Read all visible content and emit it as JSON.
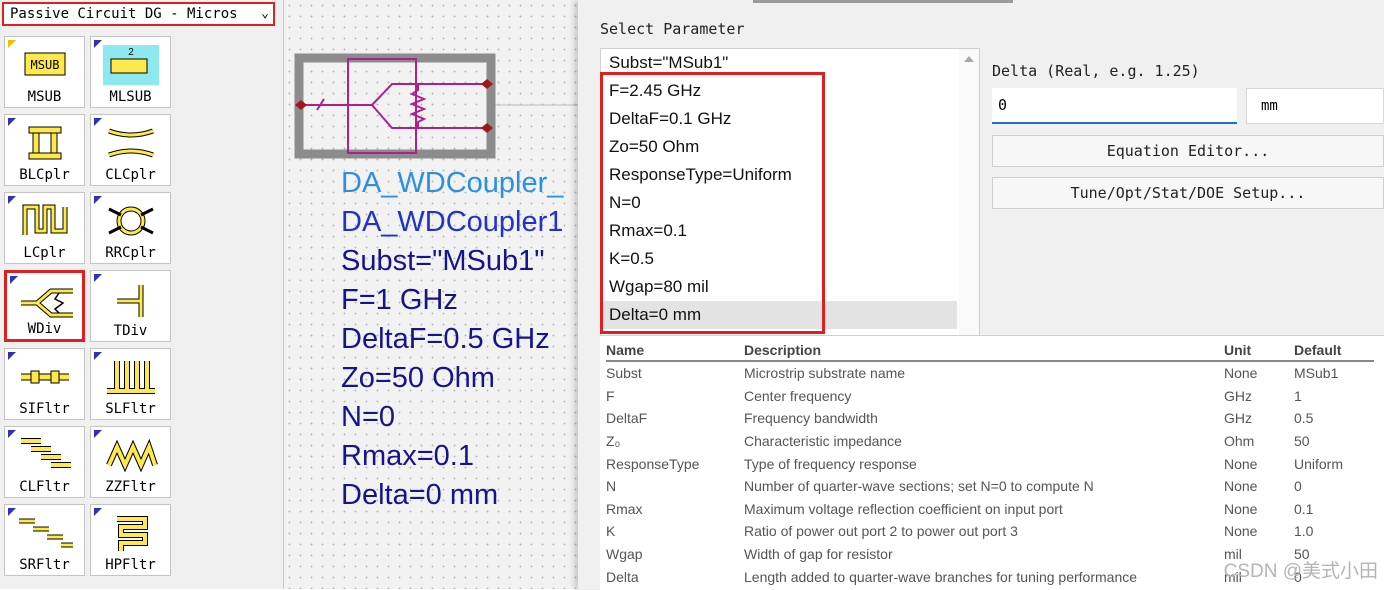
{
  "library_selector": {
    "value": "Passive Circuit DG - Micros"
  },
  "palette": {
    "items": [
      {
        "label": "MSUB",
        "icon": "msub-icon"
      },
      {
        "label": "MLSUB",
        "icon": "mlsub-icon",
        "badge": "2"
      },
      {
        "label": "BLCplr",
        "icon": "blcplr-icon"
      },
      {
        "label": "CLCplr",
        "icon": "clcplr-icon"
      },
      {
        "label": "LCplr",
        "icon": "lcplr-icon"
      },
      {
        "label": "RRCplr",
        "icon": "rrcplr-icon"
      },
      {
        "label": "WDiv",
        "icon": "wdiv-icon",
        "selected": true
      },
      {
        "label": "TDiv",
        "icon": "tdiv-icon"
      },
      {
        "label": "SIFltr",
        "icon": "sifltr-icon"
      },
      {
        "label": "SLFltr",
        "icon": "slfltr-icon"
      },
      {
        "label": "CLFltr",
        "icon": "clfltr-icon"
      },
      {
        "label": "ZZFltr",
        "icon": "zzfltr-icon"
      },
      {
        "label": "SRFltr",
        "icon": "srfltr-icon"
      },
      {
        "label": "HPFltr",
        "icon": "hpfltr-icon"
      }
    ]
  },
  "canvas": {
    "component_lines": [
      {
        "text": "DA_WDCoupler_",
        "color": "#2b8fe6"
      },
      {
        "text": "DA_WDCoupler1",
        "color": "#1f33c8"
      },
      {
        "text": "Subst=\"MSub1\"",
        "color": "#14148c"
      },
      {
        "text": "F=1 GHz",
        "color": "#14148c"
      },
      {
        "text": "DeltaF=0.5 GHz",
        "color": "#14148c"
      },
      {
        "text": "Zo=50 Ohm",
        "color": "#14148c"
      },
      {
        "text": "N=0",
        "color": "#14148c"
      },
      {
        "text": "Rmax=0.1",
        "color": "#14148c"
      },
      {
        "text": "Delta=0 mm",
        "color": "#14148c"
      }
    ]
  },
  "dialog": {
    "select_parameter_label": "Select Parameter",
    "parameters": [
      "Subst=\"MSub1\"",
      "F=2.45 GHz",
      "DeltaF=0.1 GHz",
      "Zo=50 Ohm",
      "ResponseType=Uniform",
      "N=0",
      "Rmax=0.1",
      "K=0.5",
      "Wgap=80 mil",
      "Delta=0 mm"
    ],
    "selected_parameter": "Delta=0 mm",
    "delta_label": "Delta (Real, e.g. 1.25)",
    "delta_value": "0",
    "unit_value": "mm",
    "equation_editor_label": "Equation Editor...",
    "tune_setup_label": "Tune/Opt/Stat/DOE Setup..."
  },
  "documentation": {
    "headers": [
      "Name",
      "Description",
      "Unit",
      "Default"
    ],
    "rows": [
      [
        "Subst",
        "Microstrip substrate name",
        "None",
        "MSub1"
      ],
      [
        "F",
        "Center frequency",
        "GHz",
        "1"
      ],
      [
        "DeltaF",
        "Frequency bandwidth",
        "GHz",
        "0.5"
      ],
      [
        "Z₀",
        "Characteristic impedance",
        "Ohm",
        "50"
      ],
      [
        "ResponseType",
        "Type of frequency response",
        "None",
        "Uniform"
      ],
      [
        "N",
        "Number of quarter-wave sections; set N=0 to compute N",
        "None",
        "0"
      ],
      [
        "Rmax",
        "Maximum voltage reflection coefficient on input port",
        "None",
        "0.1"
      ],
      [
        "K",
        "Ratio of power out port 2 to power out port 3",
        "None",
        "1.0"
      ],
      [
        "Wgap",
        "Width of gap for resistor",
        "mil",
        "50"
      ],
      [
        "Delta",
        "Length added to quarter-wave branches for tuning performance",
        "mil",
        "0"
      ]
    ]
  },
  "watermark": "CSDN @美式小田",
  "colors": {
    "highlight_border": "#e02020",
    "component_symbol": "#b0208a",
    "input_underline": "#1f6fd1"
  }
}
